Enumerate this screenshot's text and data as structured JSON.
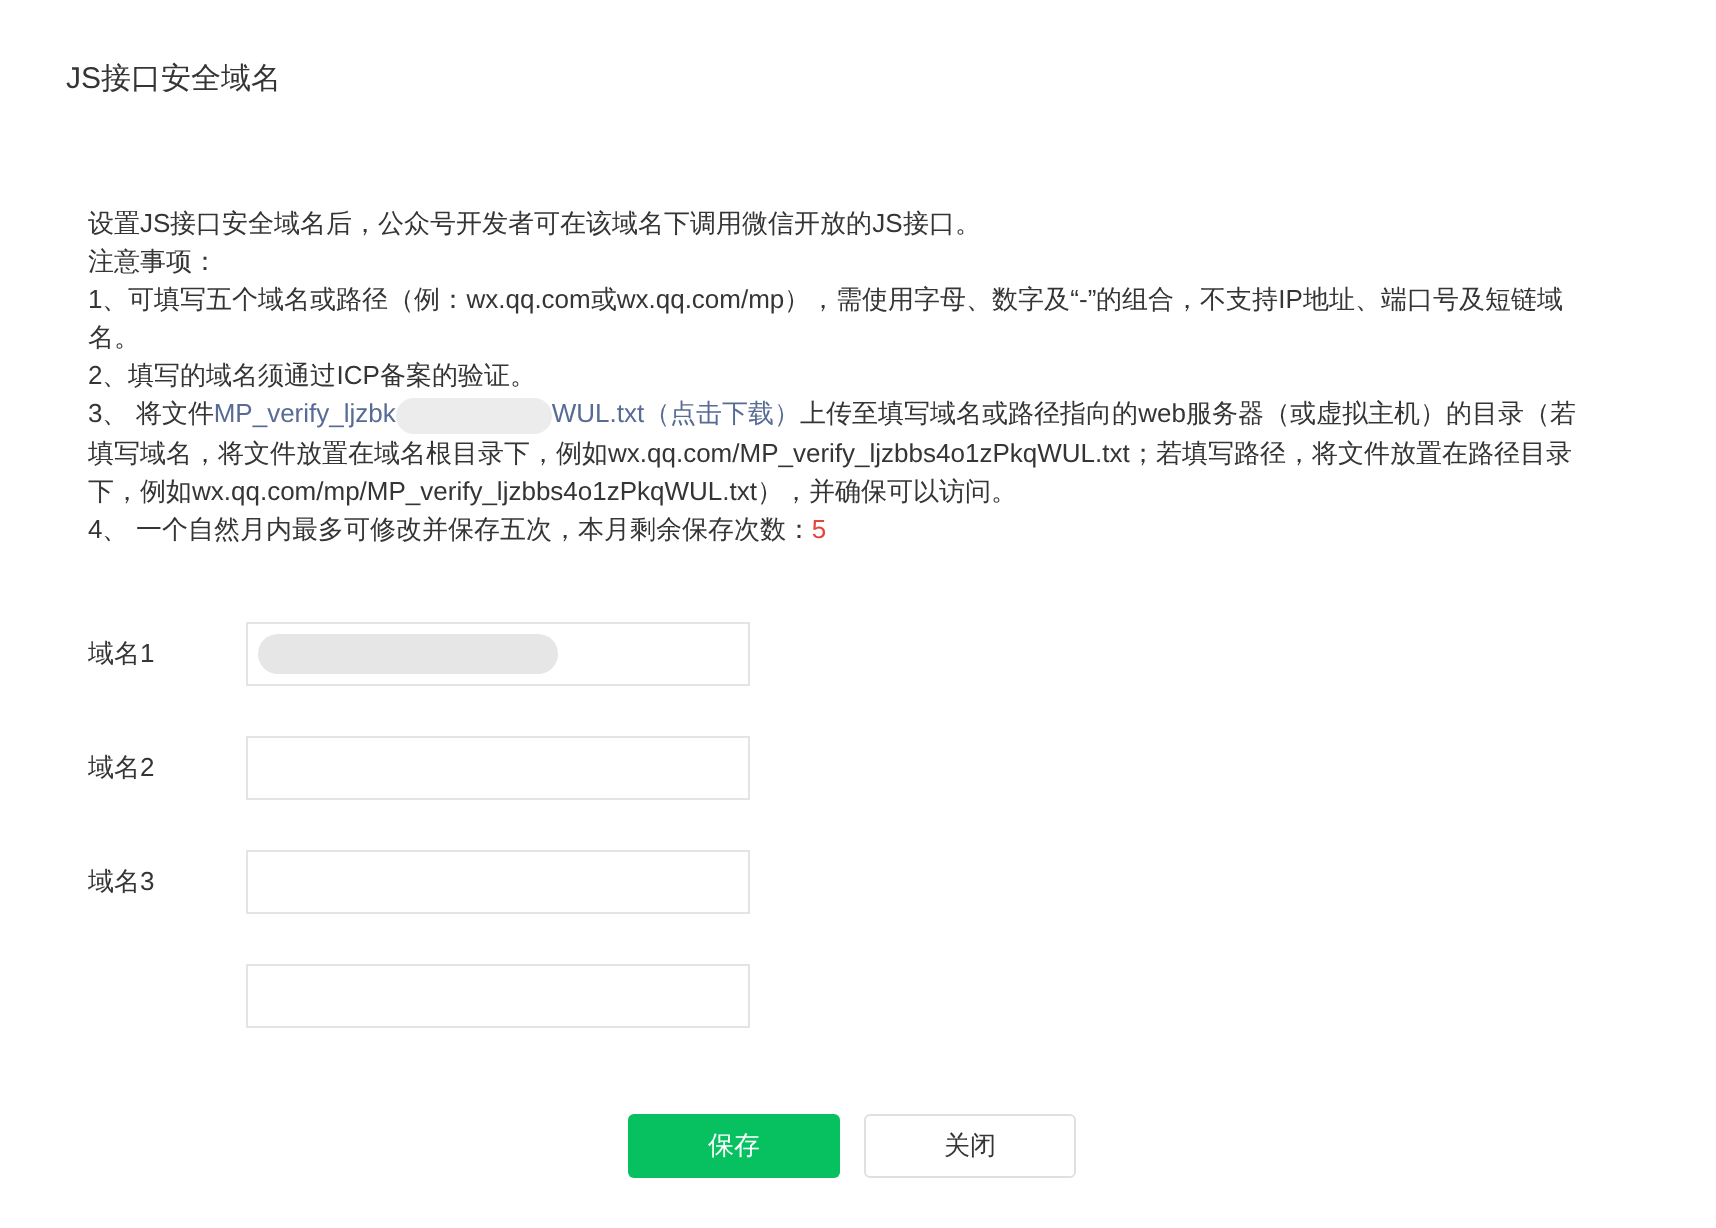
{
  "title": "JS接口安全域名",
  "intro": "设置JS接口安全域名后，公众号开发者可在该域名下调用微信开放的JS接口。",
  "notes_heading": "注意事项：",
  "notes": [
    {
      "kind": "text",
      "text": "1、可填写五个域名或路径（例：wx.qq.com或wx.qq.com/mp），需使用字母、数字及“-”的组合，不支持IP地址、端口号及短链域名。"
    },
    {
      "kind": "text",
      "text": "2、填写的域名须通过ICP备案的验证。"
    },
    {
      "kind": "file",
      "prefix": "3、 将文件",
      "link_start": "MP_verify_ljzbk",
      "link_end": "WUL.txt（点击下载）",
      "suffix": "上传至填写域名或路径指向的web服务器（或虚拟主机）的目录（若填写域名，将文件放置在域名根目录下，例如wx.qq.com/MP_verify_ljzbbs4o1zPkqWUL.txt；若填写路径，将文件放置在路径目录下，例如wx.qq.com/mp/MP_verify_ljzbbs4o1zPkqWUL.txt），并确保可以访问。"
    },
    {
      "kind": "count",
      "text": "4、 一个自然月内最多可修改并保存五次，本月剩余保存次数：",
      "count": "5"
    }
  ],
  "fields": [
    {
      "label": "域名1",
      "kind": "redacted"
    },
    {
      "label": "域名2",
      "kind": "empty"
    },
    {
      "label": "域名3",
      "kind": "empty"
    },
    {
      "kind": "empty"
    }
  ],
  "buttons": [
    {
      "label": "保存",
      "kind": "primary"
    },
    {
      "label": "关闭",
      "kind": "secondary"
    }
  ]
}
